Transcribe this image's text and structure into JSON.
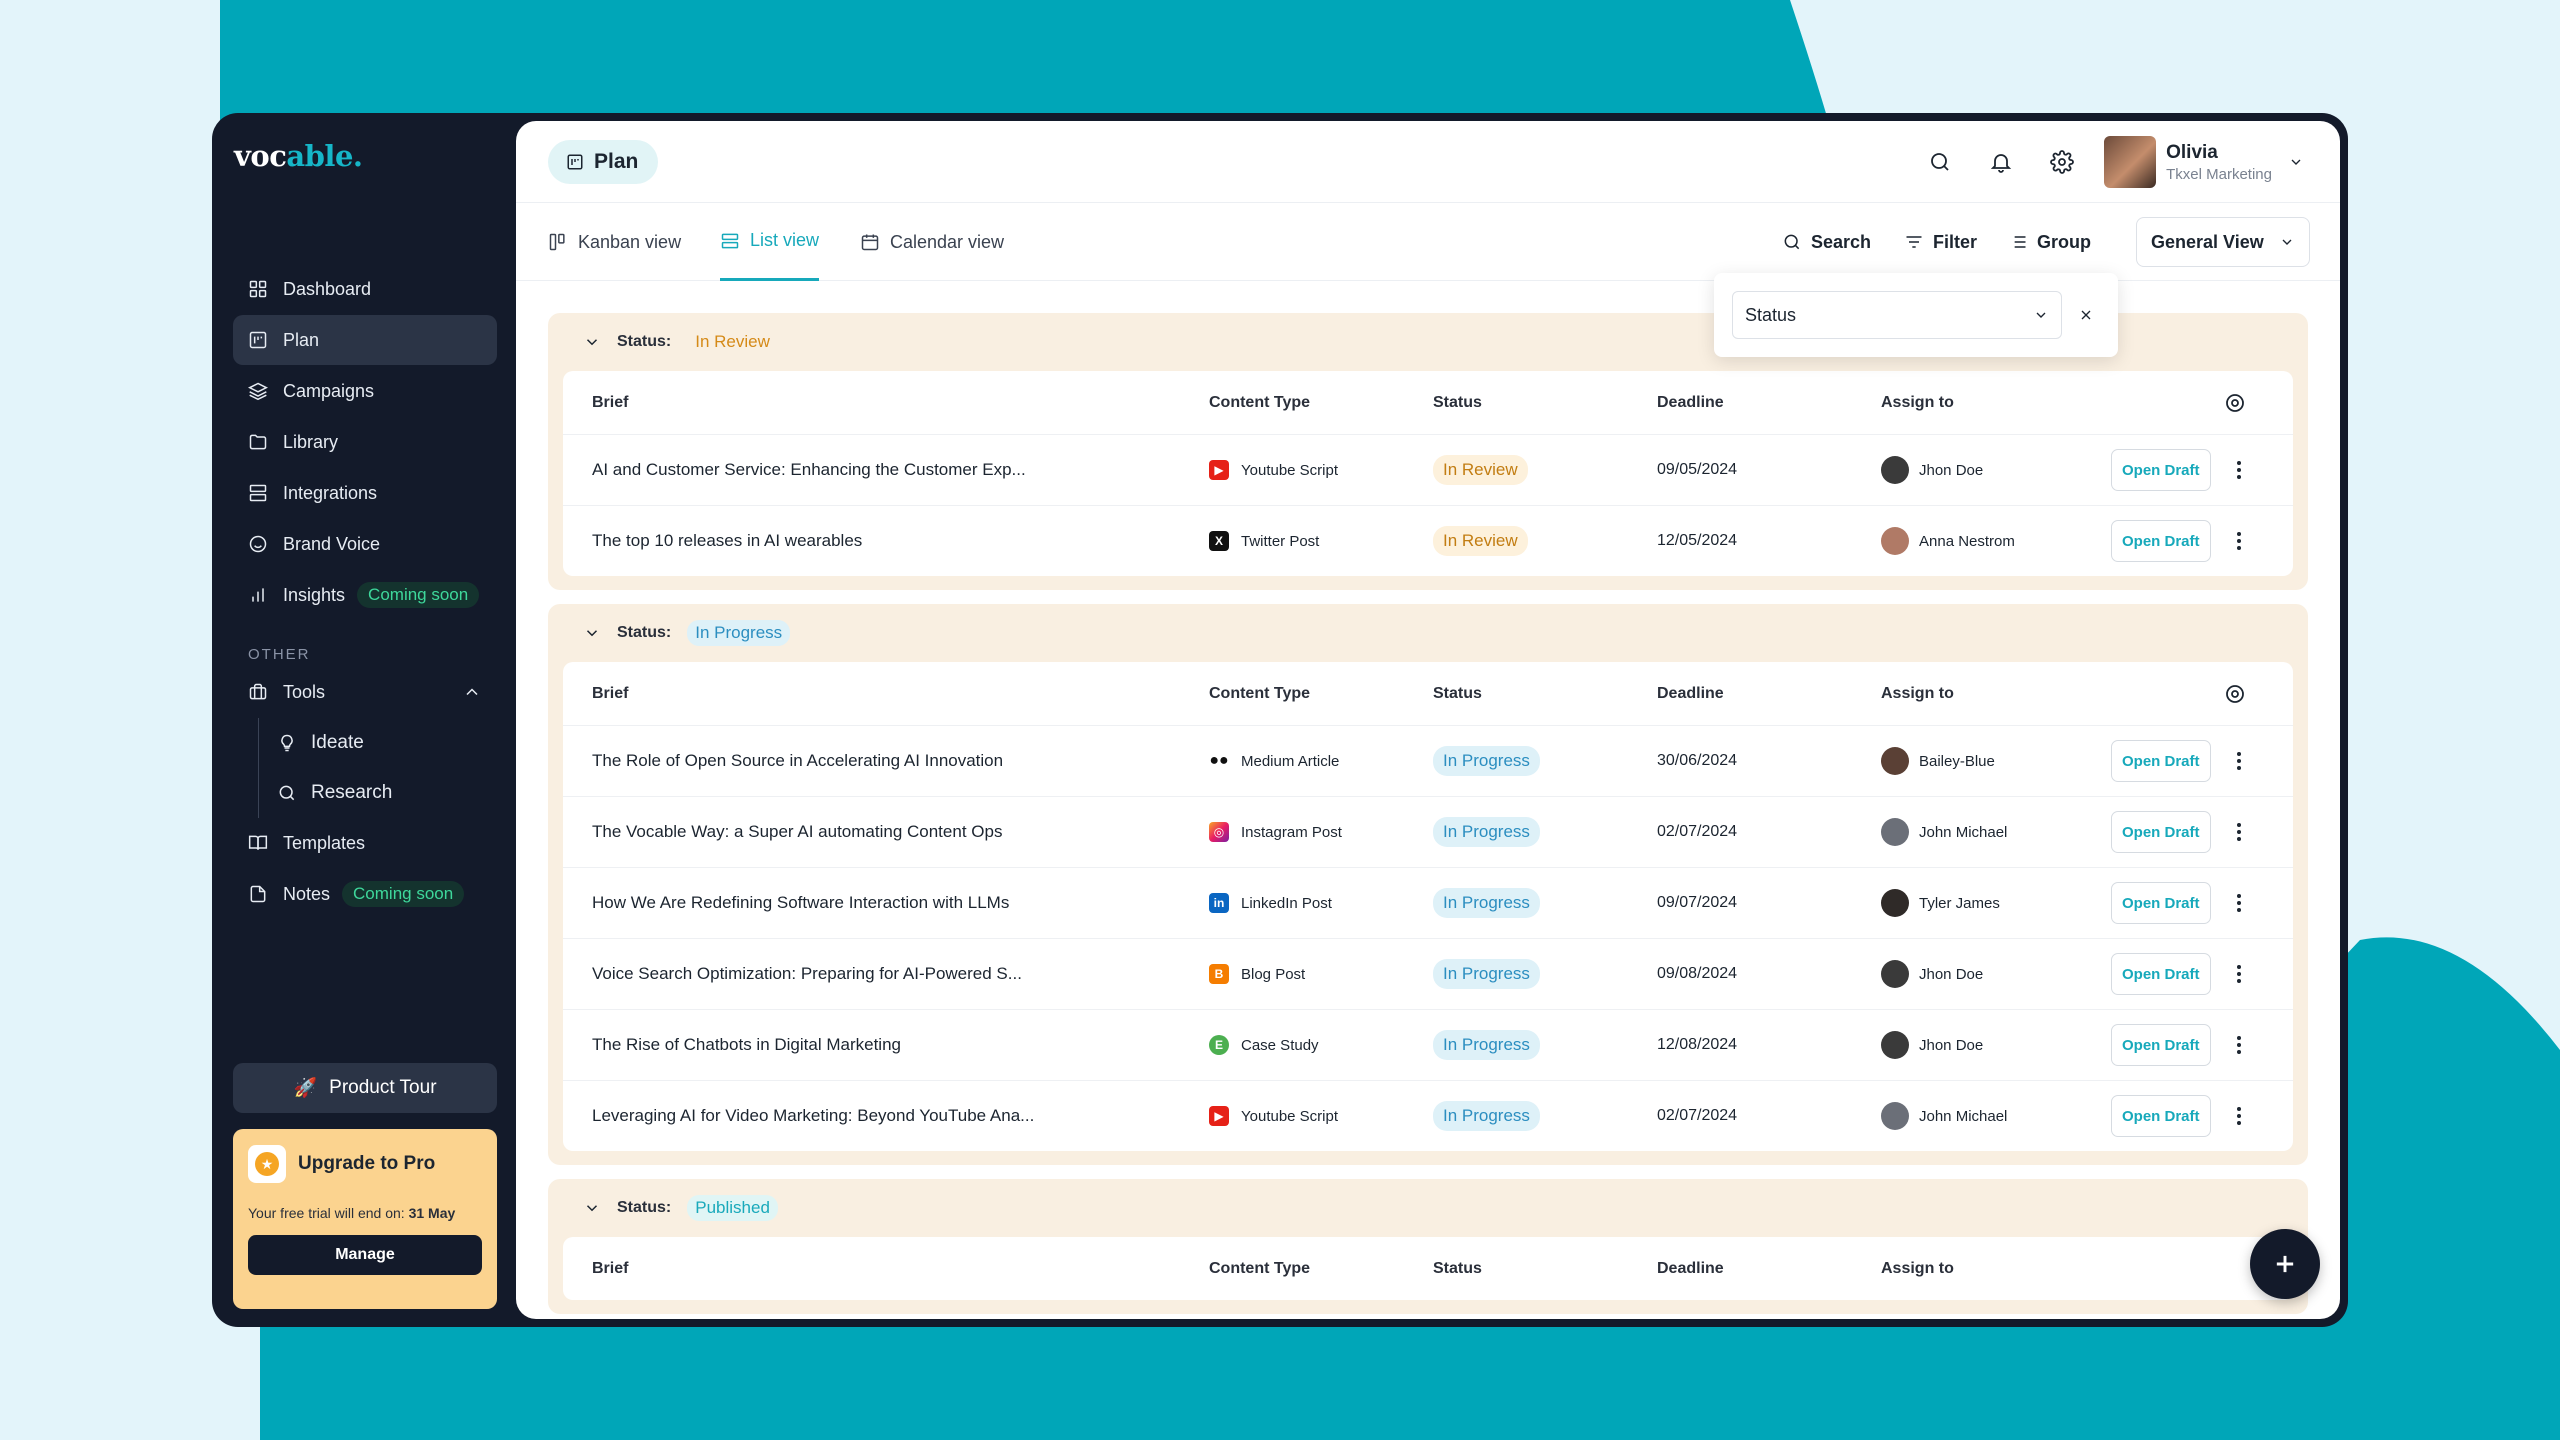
{
  "brand": {
    "logo_main": "voc",
    "logo_accent": "able."
  },
  "sidebar": {
    "items": [
      {
        "label": "Dashboard",
        "icon": "grid-icon",
        "active": false
      },
      {
        "label": "Plan",
        "icon": "plan-icon",
        "active": true
      },
      {
        "label": "Campaigns",
        "icon": "layers-icon",
        "active": false
      },
      {
        "label": "Library",
        "icon": "folder-icon",
        "active": false
      },
      {
        "label": "Integrations",
        "icon": "server-icon",
        "active": false
      },
      {
        "label": "Brand Voice",
        "icon": "smile-icon",
        "active": false
      },
      {
        "label": "Insights",
        "icon": "bar-chart-icon",
        "badge": "Coming soon"
      }
    ],
    "other_label": "OTHER",
    "tools_label": "Tools",
    "tools_items": [
      {
        "label": "Ideate",
        "icon": "lightbulb-icon"
      },
      {
        "label": "Research",
        "icon": "search-icon"
      }
    ],
    "templates_label": "Templates",
    "notes_label": "Notes",
    "notes_badge": "Coming soon",
    "product_tour": "Product Tour",
    "upgrade": {
      "title": "Upgrade to Pro",
      "trial_text": "Your free trial will end on: ",
      "trial_date": "31 May",
      "manage": "Manage"
    }
  },
  "header": {
    "page_title": "Plan",
    "user_name": "Olivia",
    "user_org": "Tkxel Marketing"
  },
  "tabs": {
    "kanban": "Kanban view",
    "list": "List view",
    "calendar": "Calendar view",
    "search": "Search",
    "filter": "Filter",
    "group": "Group",
    "view_select": "General View"
  },
  "filter_popup": {
    "field": "Status"
  },
  "columns": {
    "brief": "Brief",
    "content_type": "Content Type",
    "status": "Status",
    "deadline": "Deadline",
    "assign": "Assign to"
  },
  "groups": {
    "status_prefix": "Status:",
    "review_label": "In Review",
    "progress_label": "In Progress",
    "published_label": "Published"
  },
  "open_draft_label": "Open Draft",
  "review_rows": [
    {
      "brief": "AI and Customer Service: Enhancing the Customer Exp...",
      "type": "Youtube Script",
      "status": "In Review",
      "deadline": "09/05/2024",
      "assignee": "Jhon Doe"
    },
    {
      "brief": "The top 10 releases in AI wearables",
      "type": "Twitter Post",
      "status": "In Review",
      "deadline": "12/05/2024",
      "assignee": "Anna Nestrom"
    }
  ],
  "progress_rows": [
    {
      "brief": "The Role of Open Source in Accelerating AI Innovation",
      "type": "Medium Article",
      "status": "In Progress",
      "deadline": "30/06/2024",
      "assignee": "Bailey-Blue"
    },
    {
      "brief": "The Vocable Way: a Super AI automating Content Ops",
      "type": "Instagram Post",
      "status": "In Progress",
      "deadline": "02/07/2024",
      "assignee": "John Michael"
    },
    {
      "brief": "How We Are Redefining Software Interaction with LLMs",
      "type": "LinkedIn Post",
      "status": "In Progress",
      "deadline": "09/07/2024",
      "assignee": "Tyler James"
    },
    {
      "brief": "Voice Search Optimization: Preparing for AI-Powered S...",
      "type": "Blog Post",
      "status": "In Progress",
      "deadline": "09/08/2024",
      "assignee": "Jhon Doe"
    },
    {
      "brief": "The Rise of Chatbots in Digital Marketing",
      "type": "Case Study",
      "status": "In Progress",
      "deadline": "12/08/2024",
      "assignee": "Jhon Doe"
    },
    {
      "brief": "Leveraging AI for Video Marketing: Beyond YouTube Ana...",
      "type": "Youtube Script",
      "status": "In Progress",
      "deadline": "02/07/2024",
      "assignee": "John Michael"
    }
  ],
  "colors": {
    "accent": "#17a9bb",
    "sidebar": "#131a2a",
    "group_bg": "#f9efe1",
    "background_teal": "#00a5b8"
  }
}
